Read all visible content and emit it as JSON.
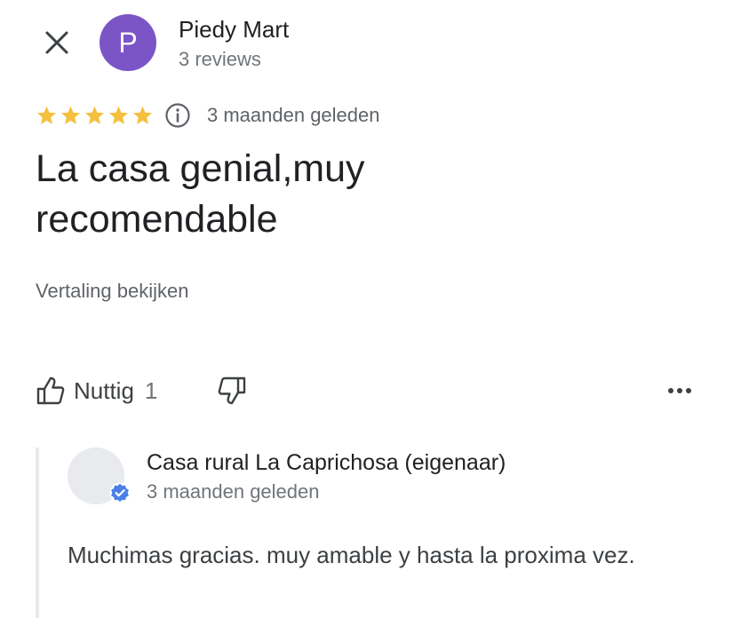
{
  "reviewer": {
    "avatar_letter": "P",
    "avatar_color": "#7b55c6",
    "name": "Piedy Mart",
    "review_count": "3 reviews"
  },
  "review": {
    "rating": 5,
    "max_rating": 5,
    "star_color": "#f4c03d",
    "date": "3 maanden geleden",
    "text": "La casa genial,muy recomendable",
    "translate_label": "Vertaling bekijken"
  },
  "actions": {
    "helpful_label": "Nuttig",
    "helpful_count": "1",
    "icons": {
      "close": "close-icon",
      "info": "info-icon",
      "helpful": "thumbs-up-icon",
      "not_helpful": "thumbs-down-icon",
      "more": "more-horizontal-icon"
    }
  },
  "owner_reply": {
    "name": "Casa rural La Caprichosa (eigenaar)",
    "date": "3 maanden geleden",
    "text": "Muchimas gracias. muy amable y hasta la proxima vez.",
    "verified_color": "#4a80e8"
  }
}
